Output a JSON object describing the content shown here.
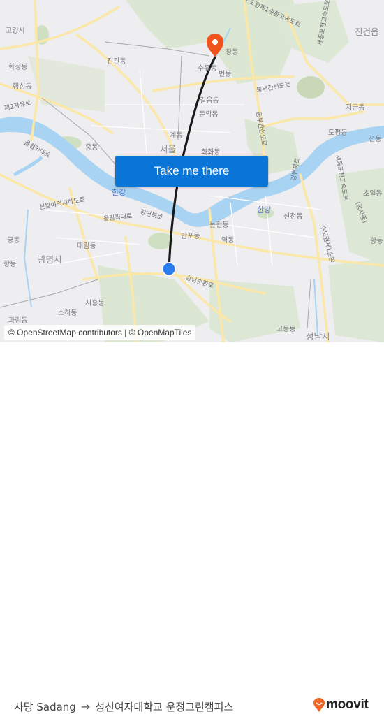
{
  "map": {
    "labels": {
      "goyang": "고양시",
      "jingwan": "진관동",
      "hwajeong": "화정동",
      "haengsin": "행신동",
      "jayuro2": "제2자유로",
      "olympic1": "올림픽대로",
      "jungdong": "중동",
      "gyedong": "계동",
      "seoul": "서울",
      "suyu": "수유동",
      "beon": "번동",
      "chang": "창동",
      "jeoeum": "길음동",
      "donam": "돈암동",
      "hwahwa": "화화동",
      "ring1": "수도권제1순환고속도로",
      "sejongpocheon": "세종포천고속도로",
      "jingeon": "진건읍",
      "bukbu": "북부간선도로",
      "dongbu": "동부간선도로",
      "jigeum": "지금동",
      "topyeong": "토평동",
      "seondong": "선동",
      "gangbyeon_n": "강변북로",
      "sejong2": "세종포천고속도로",
      "hangang1": "한강",
      "hangang2": "한강",
      "sinwol": "신월여의지하도로",
      "olympic2": "올림픽대로",
      "gangbyeon": "강변북로",
      "gungdong": "궁동",
      "daerim": "대림동",
      "gwangmyeong": "광명시",
      "banpo": "반포동",
      "nonhyeon": "논현동",
      "yeok": "역동",
      "sincheon": "신천동",
      "choil": "초일동",
      "gongsa": "(공사중)",
      "hangdong_e": "항동",
      "ring1b": "수도권제1순환",
      "hangdong_w": "항동",
      "siheung": "시흥동",
      "soha": "소하동",
      "gwarim": "과림동",
      "gangnam": "강남순환로",
      "godeung": "고등동",
      "seongnam": "성남시"
    },
    "colors": {
      "land": "#eeeef0",
      "park": "#cfe0c2",
      "forest": "#dbe6d3",
      "water": "#a9d3f2",
      "road": "#fbe7a8",
      "route_line": "#1a1a1a",
      "origin": "#2a7ef0",
      "destination": "#f0541c"
    }
  },
  "cta": {
    "label": "Take me there"
  },
  "attribution": {
    "text": "© OpenStreetMap contributors | © OpenMapTiles"
  },
  "footer": {
    "origin": "사당 Sadang",
    "arrow_icon": "→",
    "destination": "성신여자대학교 운정그린캠퍼스",
    "brand": "moovit",
    "brand_color": "#f26522"
  }
}
